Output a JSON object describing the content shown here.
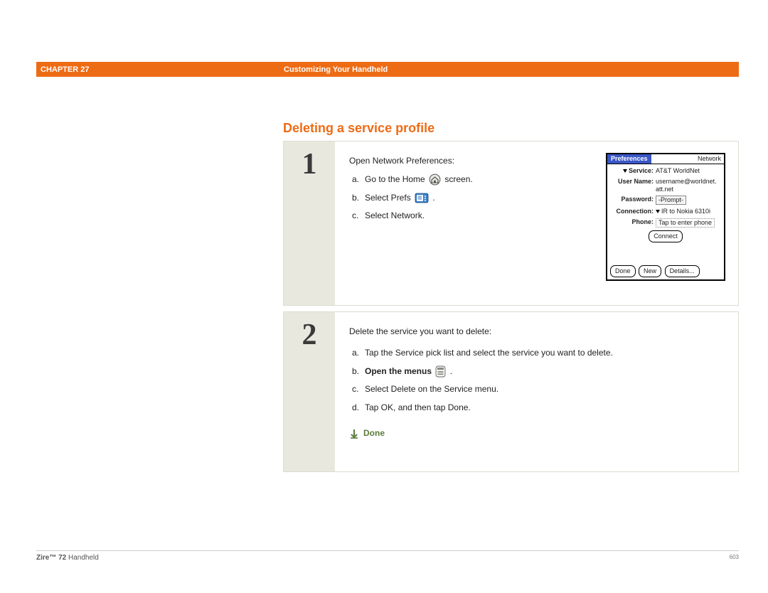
{
  "header": {
    "chapter": "CHAPTER 27",
    "title": "Customizing Your Handheld"
  },
  "section_title": "Deleting a service profile",
  "step1": {
    "num": "1",
    "intro": "Open Network Preferences:",
    "a_pre": "Go to the Home ",
    "a_post": " screen.",
    "b_pre": "Select Prefs ",
    "b_post": " .",
    "c": "Select Network."
  },
  "palm": {
    "title_left": "Preferences",
    "title_right": "Network",
    "service_label": "Service:",
    "service_value": "AT&T WorldNet",
    "user_label": "User Name:",
    "user_value_1": "username@worldnet.",
    "user_value_2": "att.net",
    "password_label": "Password:",
    "password_value": "-Prompt-",
    "connection_label": "Connection:",
    "connection_value": "IR to Nokia 6310i",
    "phone_label": "Phone:",
    "phone_value": "Tap to enter phone",
    "connect_btn": "Connect",
    "done_btn": "Done",
    "new_btn": "New",
    "details_btn": "Details..."
  },
  "step2": {
    "num": "2",
    "intro": "Delete the service you want to delete:",
    "a": "Tap the Service pick list and select the service you want to delete.",
    "b_bold": "Open the menus",
    "b_post": " .",
    "c": "Select Delete on the Service menu.",
    "d": "Tap OK, and then tap Done.",
    "done": "Done"
  },
  "footer": {
    "product_bold": "Zire™ 72",
    "product_rest": " Handheld",
    "page": "603"
  }
}
